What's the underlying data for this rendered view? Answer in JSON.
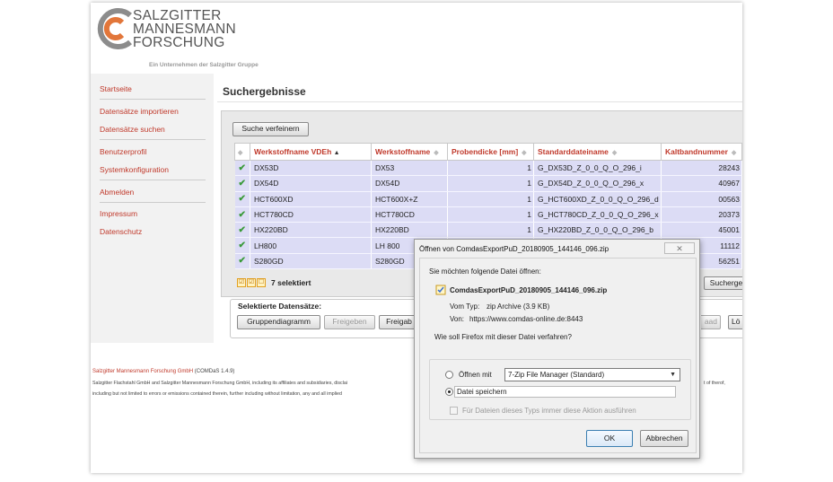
{
  "header": {
    "logo_lines": [
      "SALZGITTER",
      "MANNESMANN",
      "FORSCHUNG"
    ],
    "logo_subtitle": "Ein Unternehmen der Salzgitter Gruppe",
    "colors": {
      "brand_red": "#c0392b",
      "logo_orange": "#e2763a",
      "logo_gray": "#8c8c8c"
    }
  },
  "sidebar": {
    "items": [
      {
        "label": "Startseite"
      },
      {
        "label": "Datensätze importieren"
      },
      {
        "label": "Datensätze suchen"
      },
      {
        "label": "Benutzerprofil"
      },
      {
        "label": "Systemkonfiguration"
      },
      {
        "label": "Abmelden"
      },
      {
        "label": "Impressum"
      },
      {
        "label": "Datenschutz"
      }
    ]
  },
  "main": {
    "title": "Suchergebnisse",
    "refine_button": "Suche verfeinern",
    "columns": [
      "Werkstoffname VDEh",
      "Werkstoffname",
      "Probendicke [mm]",
      "Standarddateiname",
      "Kaltbandnummer"
    ],
    "rows": [
      {
        "vdeh": "DX53D",
        "name": "DX53",
        "thickness": "1",
        "file": "G_DX53D_Z_0_0_Q_O_296_i",
        "band": "28243"
      },
      {
        "vdeh": "DX54D",
        "name": "DX54D",
        "thickness": "1",
        "file": "G_DX54D_Z_0_0_Q_O_296_x",
        "band": "40967"
      },
      {
        "vdeh": "HCT600XD",
        "name": "HCT600X+Z",
        "thickness": "1",
        "file": "G_HCT600XD_Z_0_0_Q_O_296_d",
        "band": "00563"
      },
      {
        "vdeh": "HCT780CD",
        "name": "HCT780CD",
        "thickness": "1",
        "file": "G_HCT780CD_Z_0_0_Q_O_296_x",
        "band": "20373"
      },
      {
        "vdeh": "HX220BD",
        "name": "HX220BD",
        "thickness": "1",
        "file": "G_HX220BD_Z_0_0_Q_O_296_b",
        "band": "45001"
      },
      {
        "vdeh": "LH800",
        "name": "LH 800",
        "thickness": "",
        "file": "",
        "band": "11112"
      },
      {
        "vdeh": "S280GD",
        "name": "S280GD",
        "thickness": "",
        "file": "",
        "band": "56251"
      }
    ],
    "selected_count": "7 selektiert",
    "search_button_partial": "Sucherge",
    "selected_section_title": "Selektierte Datensätze:",
    "action_buttons": [
      "Gruppendiagramm",
      "Freigeben",
      "Freigab"
    ],
    "right_partial_buttons": [
      "aad",
      "Lö"
    ]
  },
  "footer": {
    "company": "Salzgitter Mannesmann Forschung GmbH",
    "version": "(COMDaS 1.4.9)",
    "line2": "Salzgitter Flachstahl GmbH and Salzgitter Mannesmann Forschung GmbH, including its affiliates and subsidiaries, disclai",
    "line2_tail": "t of therof,",
    "line3": "including but not limited to errors or emissions contained therein, further including without limitation, any and all implied"
  },
  "dialog": {
    "title": "Öffnen von ComdasExportPuD_20180905_144146_096.zip",
    "close_glyph": "✕",
    "question": "Sie möchten folgende Datei öffnen:",
    "filename": "ComdasExportPuD_20180905_144146_096.zip",
    "type_label": "Vom Typ:",
    "type_value": "zip Archive (3.9 KB)",
    "from_label": "Von:",
    "from_value": "https://www.comdas-online.de:8443",
    "handle_question": "Wie soll Firefox mit dieser Datei verfahren?",
    "open_with_label": "Öffnen mit",
    "open_with_value": "7-Zip File Manager (Standard)",
    "save_label": "Datei speichern",
    "remember_label": "Für Dateien dieses Typs immer diese Aktion ausführen",
    "ok": "OK",
    "cancel": "Abbrechen"
  }
}
